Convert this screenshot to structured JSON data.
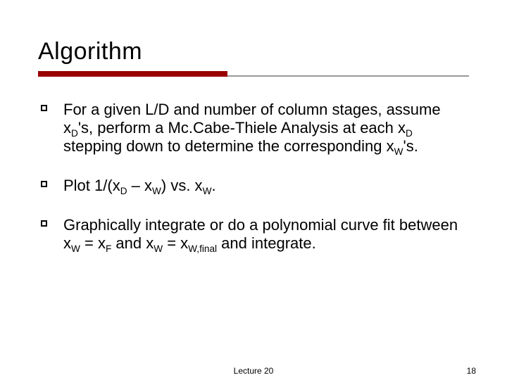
{
  "title": "Algorithm",
  "bullets": [
    {
      "pre": "For a given L/D and number of column stages, assume x",
      "sub1": "D",
      "mid1": "'s, perform a Mc.Cabe-Thiele Analysis at each x",
      "sub2": "D",
      "mid2": " stepping down to determine the corresponding x",
      "sub3": "W",
      "post": "'s."
    },
    {
      "pre": "Plot 1/(x",
      "sub1": "D",
      "mid1": " – x",
      "sub2": "W",
      "mid2": ") vs. x",
      "sub3": "W",
      "post": "."
    },
    {
      "pre": "Graphically integrate or do a polynomial curve fit between x",
      "sub1": "W",
      "mid1": " = x",
      "sub2": "F",
      "mid2": " and x",
      "sub3": "W",
      "mid3": " = x",
      "sub4": "W,final",
      "post": " and integrate."
    }
  ],
  "footer": {
    "center": "Lecture 20",
    "right": "18"
  }
}
